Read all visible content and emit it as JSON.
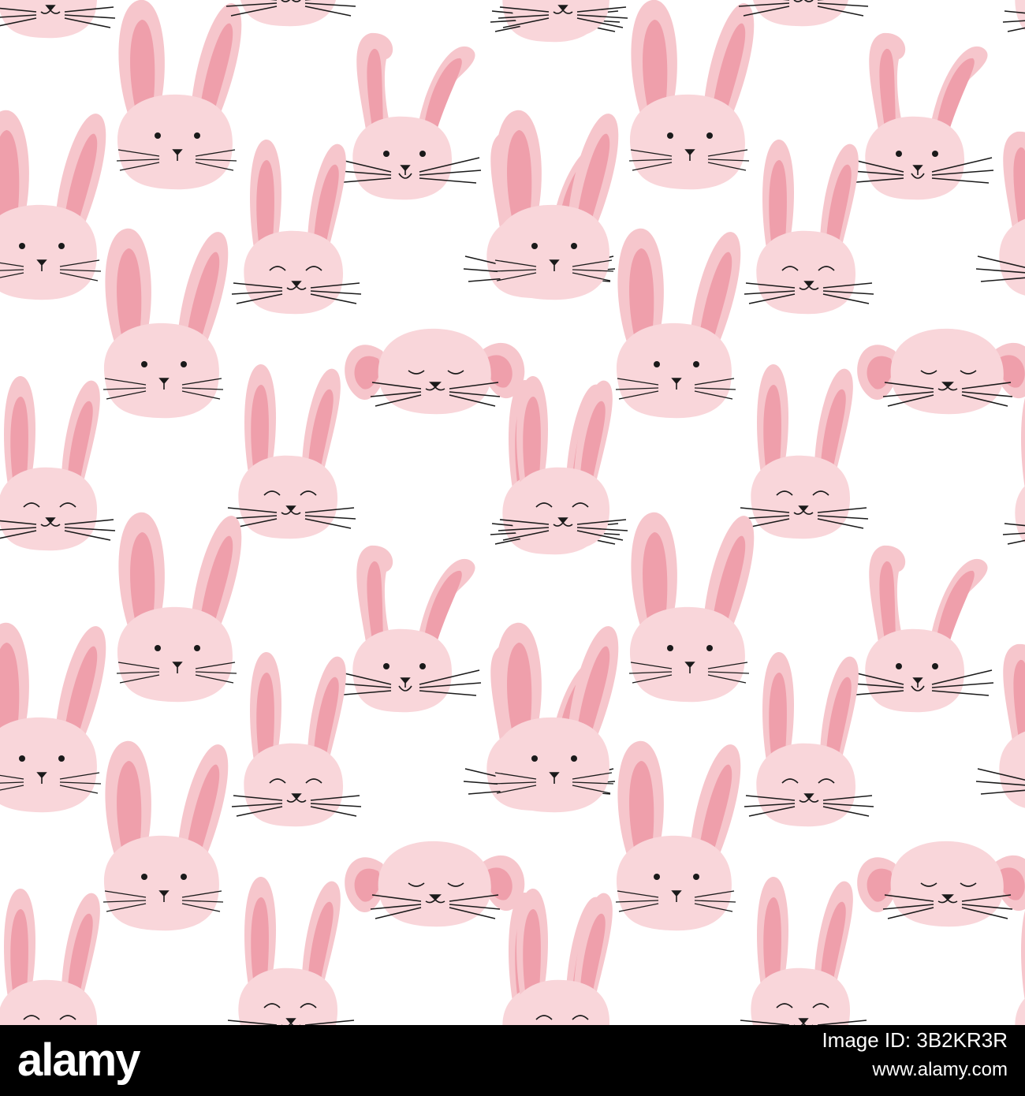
{
  "image": {
    "description_free": true,
    "background_color": "#ffffff",
    "head_color": "#f9d6da",
    "ear_outer_color": "#f6c6cc",
    "ear_inner_color": "#ef9fab",
    "line_color": "#1a1a1a"
  },
  "footer": {
    "brand": "alamy",
    "image_id_label": "Image ID: 3B2KR3R",
    "site_url": "www.alamy.com",
    "background_color": "#000000",
    "text_color": "#ffffff"
  }
}
